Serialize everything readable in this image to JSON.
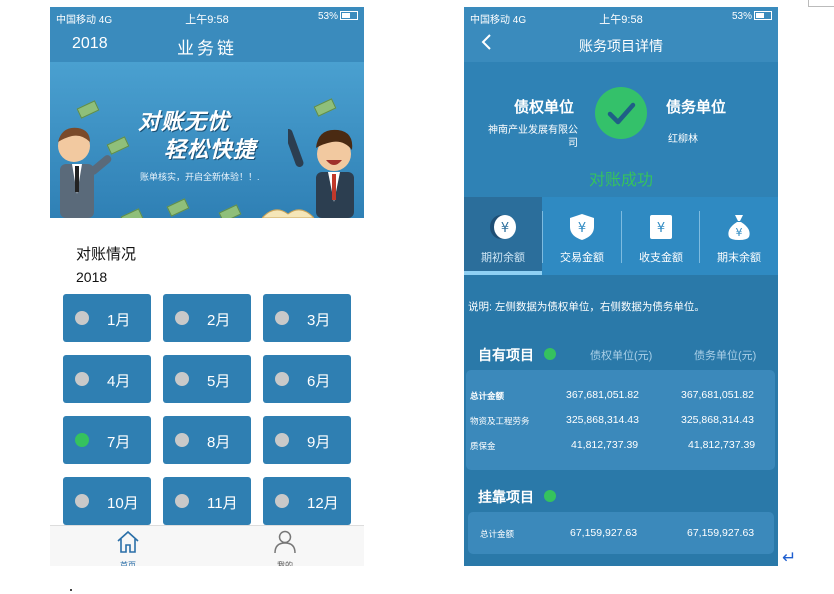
{
  "status_bar": {
    "signal": "中国移动  4G",
    "time": "上午9:58",
    "battery": "53%"
  },
  "phone1": {
    "header": {
      "year": "2018",
      "title": "业务链"
    },
    "banner": {
      "line1": "对账无忧",
      "line2": "轻松快捷",
      "subtitle": "账单核实，开启全新体验！！."
    },
    "section_title": "对账情况",
    "year": "2018",
    "months": [
      {
        "label": "1月",
        "status": "grey"
      },
      {
        "label": "2月",
        "status": "grey"
      },
      {
        "label": "3月",
        "status": "grey"
      },
      {
        "label": "4月",
        "status": "grey"
      },
      {
        "label": "5月",
        "status": "grey"
      },
      {
        "label": "6月",
        "status": "grey"
      },
      {
        "label": "7月",
        "status": "green"
      },
      {
        "label": "8月",
        "status": "grey"
      },
      {
        "label": "9月",
        "status": "grey"
      },
      {
        "label": "10月",
        "status": "grey"
      },
      {
        "label": "11月",
        "status": "grey"
      },
      {
        "label": "12月",
        "status": "grey"
      }
    ],
    "tabbar": [
      {
        "label": "首页",
        "icon": "home-icon"
      },
      {
        "label": "我的",
        "icon": "person-icon"
      }
    ]
  },
  "phone2": {
    "header": {
      "back_icon": "chevron-left-icon",
      "title": "账务项目详情"
    },
    "hero": {
      "creditor_label": "债权单位",
      "creditor_name": "神南产业发展有限公司",
      "debtor_label": "债务单位",
      "debtor_name": "红柳林",
      "status": "对账成功"
    },
    "tabs": [
      {
        "label": "期初余额",
        "icon": "coin-icon",
        "active": true
      },
      {
        "label": "交易金额",
        "icon": "shield-yuan-icon",
        "active": false
      },
      {
        "label": "收支金额",
        "icon": "receipt-yuan-icon",
        "active": false
      },
      {
        "label": "期末余额",
        "icon": "moneybag-icon",
        "active": false
      }
    ],
    "note": "说明: 左侧数据为债权单位，右侧数据为债务单位。",
    "own_items": {
      "title": "自有项目",
      "col_creditor": "债权单位(元)",
      "col_debtor": "债务单位(元)",
      "rows": [
        {
          "label": "总计金额",
          "creditor": "367,681,051.82",
          "debtor": "367,681,051.82"
        },
        {
          "label": "物资及工程劳务",
          "creditor": "325,868,314.43",
          "debtor": "325,868,314.43"
        },
        {
          "label": "质保金",
          "creditor": "41,812,737.39",
          "debtor": "41,812,737.39"
        }
      ]
    },
    "affiliated_items": {
      "title": "挂靠项目",
      "rows": [
        {
          "label": "总计金额",
          "creditor": "67,159,927.63",
          "debtor": "67,159,927.63"
        }
      ]
    }
  },
  "colors": {
    "primary": "#3a8bbd",
    "button": "#2f7fb2",
    "success": "#35c25e",
    "inactive_dot": "#c9c9c9"
  }
}
